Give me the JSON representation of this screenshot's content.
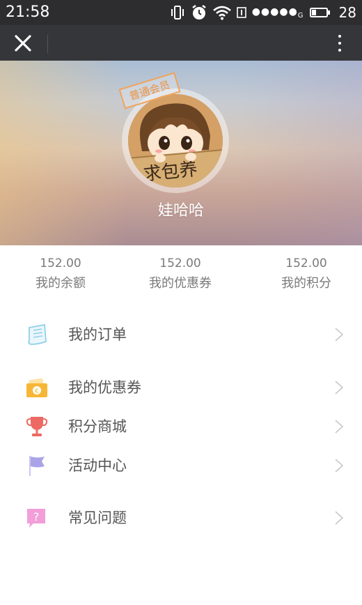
{
  "status_bar": {
    "time": "21:58",
    "battery": "28",
    "icons": [
      "vibrate-icon",
      "alarm-icon",
      "wifi-icon",
      "sim-icon",
      "signal-icon",
      "battery-icon"
    ]
  },
  "title_bar": {
    "close_icon": "close-icon",
    "more_icon": "more-vertical-icon"
  },
  "profile": {
    "member_badge": "普通会员",
    "username": "娃哈哈",
    "avatar": "cartoon-avatar"
  },
  "stats": [
    {
      "value": "152.00",
      "label": "我的余额"
    },
    {
      "value": "152.00",
      "label": "我的优惠券"
    },
    {
      "value": "152.00",
      "label": "我的积分"
    }
  ],
  "menu": [
    {
      "label": "我的订单",
      "icon": "receipt-icon",
      "color": "#8fd0ea"
    },
    {
      "label": "我的优惠券",
      "icon": "coupon-wallet-icon",
      "color": "#f7b736"
    },
    {
      "label": "积分商城",
      "icon": "trophy-icon",
      "color": "#ec6a63"
    },
    {
      "label": "活动中心",
      "icon": "flag-icon",
      "color": "#a9a4e8"
    },
    {
      "label": "常见问题",
      "icon": "question-bubble-icon",
      "color": "#f29ed9"
    }
  ]
}
